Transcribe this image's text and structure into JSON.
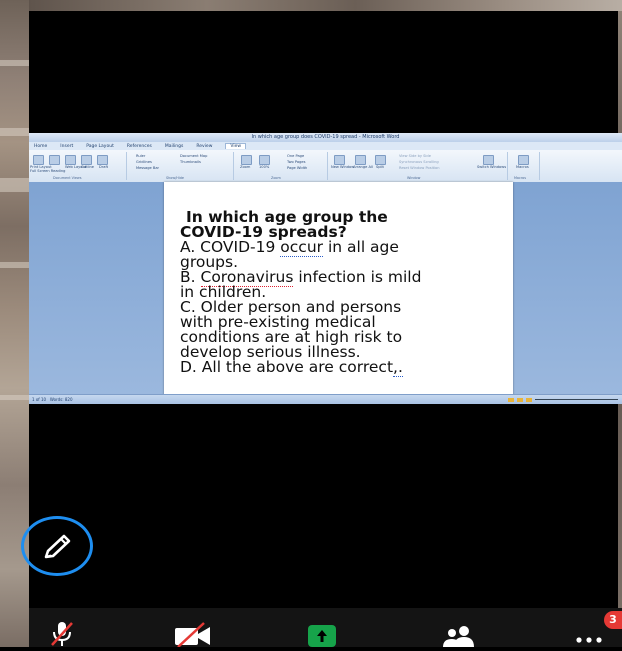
{
  "word": {
    "window_title": "In which age group does COVID-19 spread - Microsoft Word",
    "tabs": [
      "Home",
      "Insert",
      "Page Layout",
      "References",
      "Mailings",
      "Review",
      "View"
    ],
    "active_tab": "View",
    "ribbon_groups": [
      "Document Views",
      "Show/Hide",
      "Zoom",
      "Window",
      "Macros"
    ],
    "ribbon_buttons": {
      "print_layout": "Print Layout",
      "full_screen": "Full Screen Reading",
      "web_layout": "Web Layout",
      "outline": "Outline",
      "draft": "Draft",
      "ruler": "Ruler",
      "gridlines": "Gridlines",
      "message_bar": "Message Bar",
      "document_map": "Document Map",
      "thumbnails": "Thumbnails",
      "zoom": "Zoom",
      "hundred": "100%",
      "one_page": "One Page",
      "two_pages": "Two Pages",
      "page_width": "Page Width",
      "new_window": "New Window",
      "arrange_all": "Arrange All",
      "split": "Split",
      "view_side": "View Side by Side",
      "sync_scroll": "Synchronous Scrolling",
      "reset_pos": "Reset Window Position",
      "switch_windows": "Switch Windows",
      "macros": "Macros"
    },
    "document": {
      "question_line1": "In which age group the",
      "question_line2": "COVID-19 spreads?",
      "a_prefix": "A. COVID-19 ",
      "a_word": "occur",
      "a_suffix": " in all age",
      "a_line2": "groups.",
      "b_prefix": "B. ",
      "b_word": "Coronavirus",
      "b_suffix": " infection is mild",
      "b_line2": "in children.",
      "c_line1": "C. Older person and persons",
      "c_line2": "with pre-existing medical",
      "c_line3": "conditions are at high risk to",
      "c_line4": "develop serious illness.",
      "d_prefix": "D. All the above are correct",
      "d_mark": ",."
    },
    "status": {
      "page": "1 of 10",
      "words": "Words: 820"
    }
  },
  "meeting": {
    "chat_badge": "3",
    "accent_color": "#1e8ef0",
    "share_color": "#16a34a",
    "badge_color": "#e53935"
  }
}
